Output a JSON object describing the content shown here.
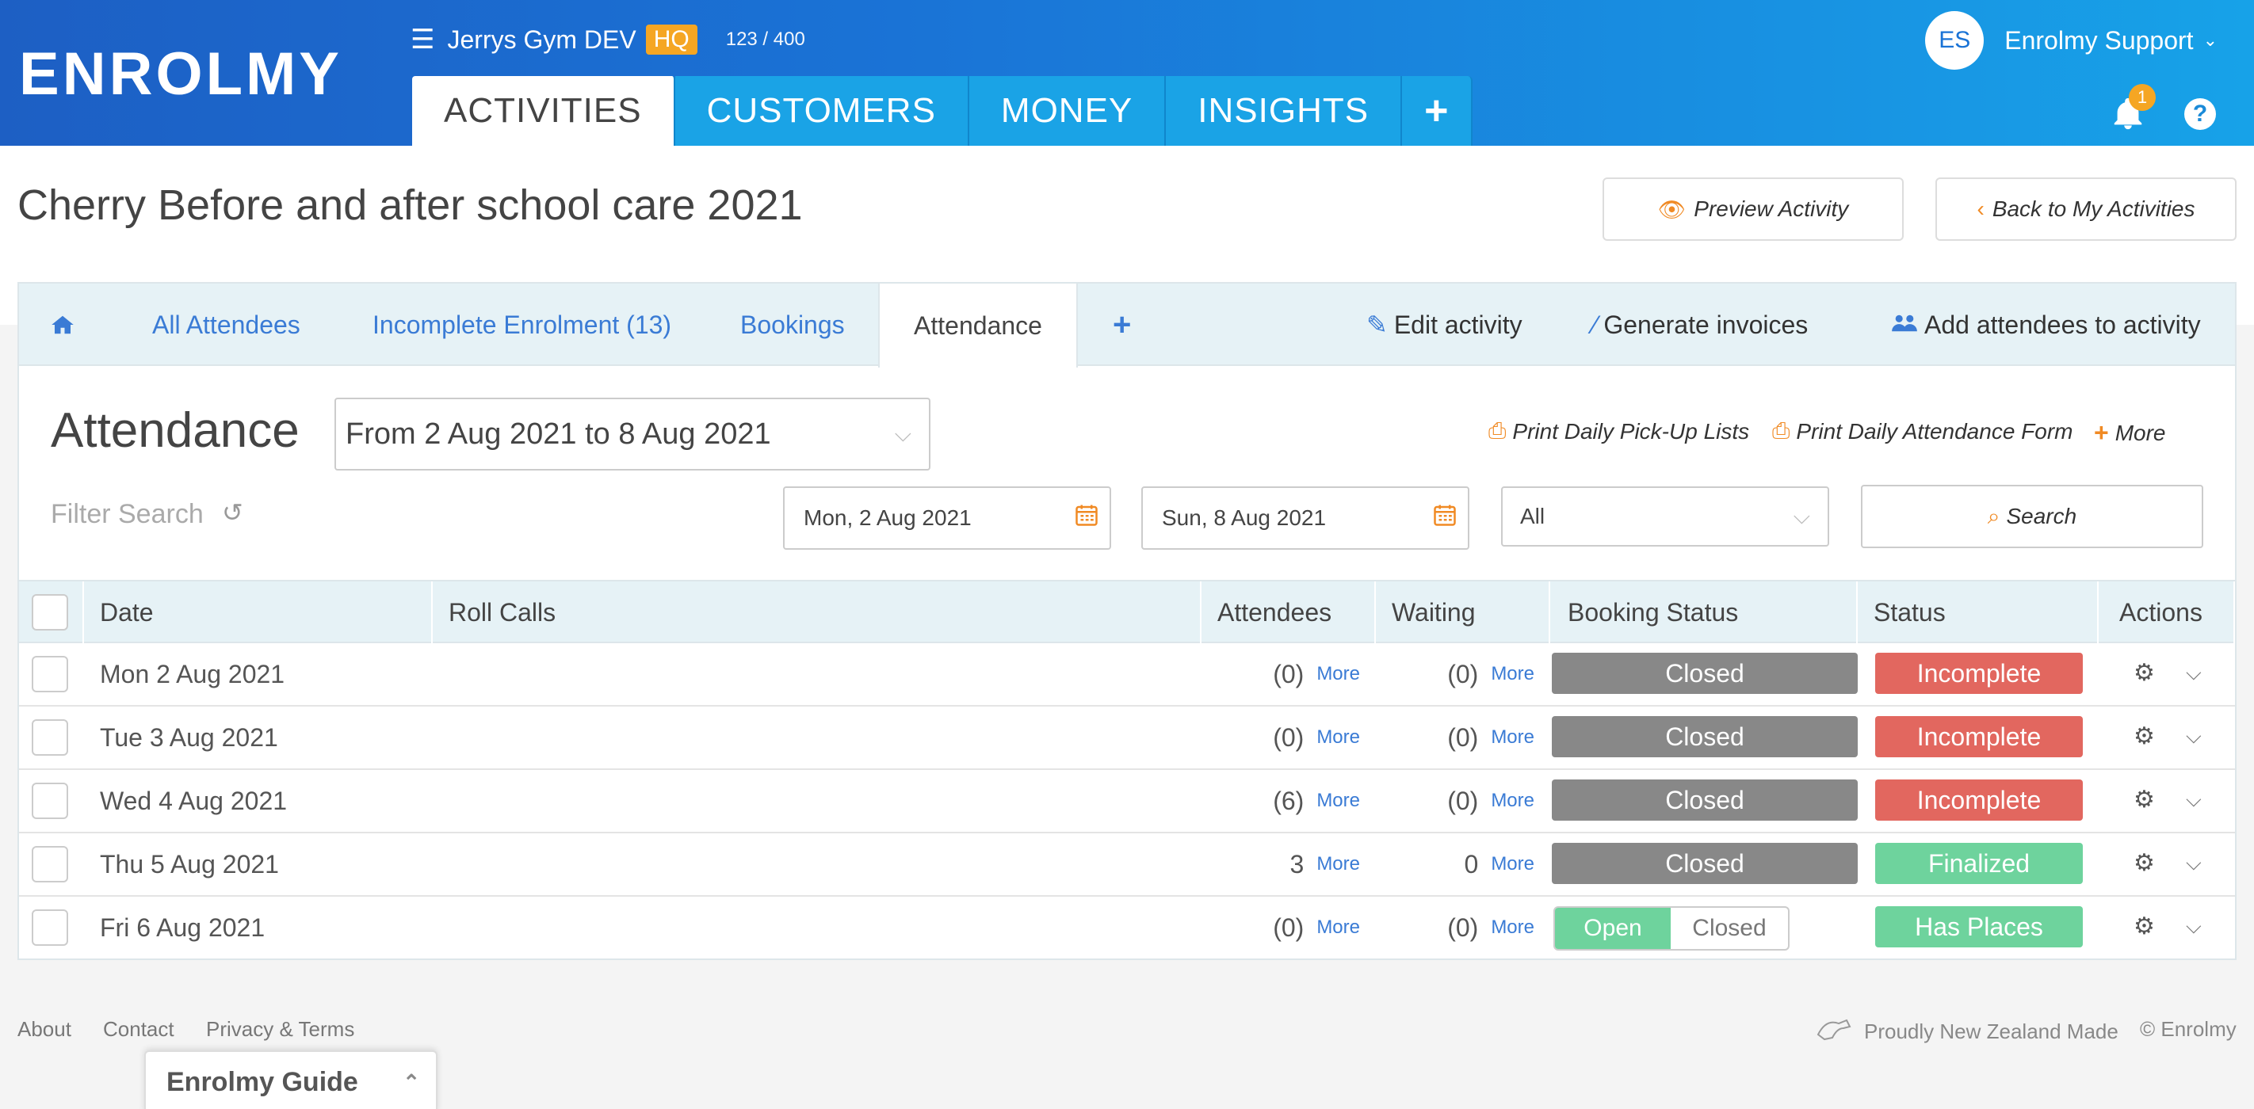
{
  "brand": {
    "logo": "ENROLMY"
  },
  "org": {
    "menu_icon": "☰",
    "name": "Jerrys Gym DEV",
    "hq_badge": "HQ",
    "count": "123 / 400"
  },
  "nav": {
    "tabs": [
      "ACTIVITIES",
      "CUSTOMERS",
      "MONEY",
      "INSIGHTS"
    ],
    "plus": "+"
  },
  "user": {
    "initials": "ES",
    "name": "Enrolmy Support",
    "notification_count": "1",
    "help": "?"
  },
  "page": {
    "title": "Cherry Before and after school care 2021",
    "preview_button": "Preview Activity",
    "back_button": "Back to My Activities"
  },
  "subtabs": {
    "home_icon": "home-icon",
    "all_attendees": "All Attendees",
    "incomplete": "Incomplete Enrolment (13)",
    "bookings": "Bookings",
    "attendance": "Attendance",
    "plus": "+",
    "edit": "Edit activity",
    "generate": "Generate invoices",
    "add_attendees": "Add attendees to activity"
  },
  "attendance": {
    "title": "Attendance",
    "range_select": "From 2 Aug 2021 to 8 Aug 2021",
    "print_pickup": "Print Daily Pick-Up Lists",
    "print_attendance": "Print Daily Attendance Form",
    "more": "More",
    "filter_label": "Filter Search",
    "start_date": "Mon, 2 Aug 2021",
    "end_date": "Sun, 8 Aug 2021",
    "status_filter": "All",
    "search": "Search"
  },
  "table": {
    "headers": [
      "Date",
      "Roll Calls",
      "Attendees",
      "Waiting",
      "Booking Status",
      "Status",
      "Actions"
    ],
    "more_label": "More",
    "rows": [
      {
        "date": "Mon 2 Aug 2021",
        "attendees": "(0)",
        "waiting": "(0)",
        "booking": "Closed",
        "status": "Incomplete"
      },
      {
        "date": "Tue 3 Aug 2021",
        "attendees": "(0)",
        "waiting": "(0)",
        "booking": "Closed",
        "status": "Incomplete"
      },
      {
        "date": "Wed 4 Aug 2021",
        "attendees": "(6)",
        "waiting": "(0)",
        "booking": "Closed",
        "status": "Incomplete"
      },
      {
        "date": "Thu 5 Aug 2021",
        "attendees": "3",
        "waiting": "0",
        "booking": "Closed",
        "status": "Finalized"
      },
      {
        "date": "Fri 6 Aug 2021",
        "attendees": "(0)",
        "waiting": "(0)",
        "booking_open": "Open",
        "booking_closed": "Closed",
        "status": "Has Places"
      }
    ]
  },
  "footer": {
    "about": "About",
    "contact": "Contact",
    "privacy": "Privacy & Terms",
    "made": "Proudly New Zealand Made",
    "copyright": "© Enrolmy"
  },
  "guide": {
    "label": "Enrolmy Guide"
  },
  "colors": {
    "accent_blue": "#1a73d6",
    "orange": "#f08a24",
    "grey_pill": "#888888",
    "red_pill": "#e2675f",
    "green_pill": "#6ed39d"
  }
}
